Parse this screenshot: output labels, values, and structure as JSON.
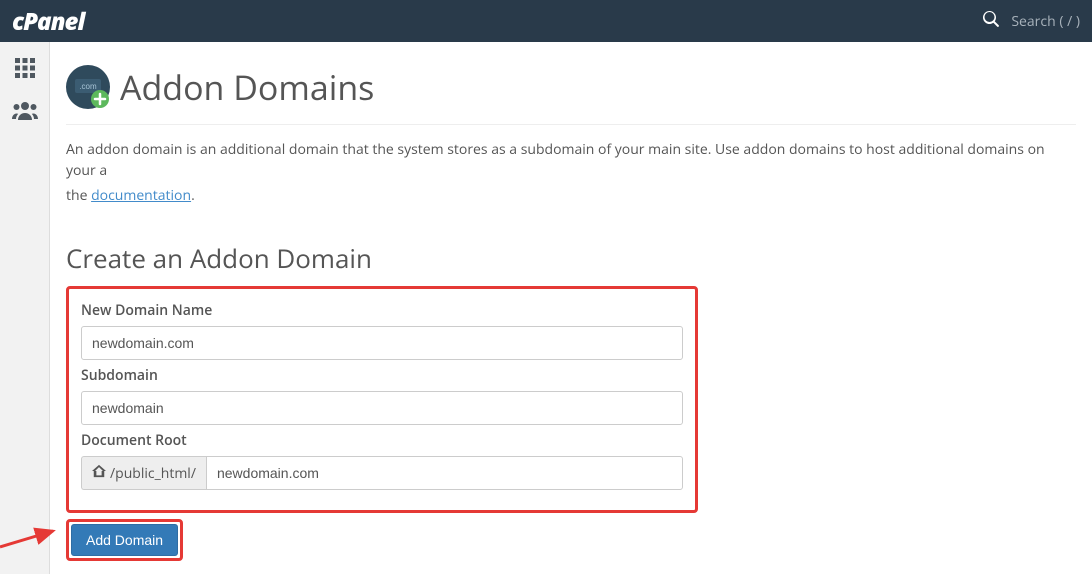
{
  "navbar": {
    "logo_text": "Panel",
    "search_placeholder": "Search ( / )"
  },
  "page": {
    "title": "Addon Domains",
    "description_prefix": "An addon domain is an additional domain that the system stores as a subdomain of your main site. Use addon domains to host additional domains on your a",
    "description_suffix_prefix": "the ",
    "documentation_link_text": "documentation",
    "description_suffix_end": "."
  },
  "form": {
    "section_title": "Create an Addon Domain",
    "new_domain_label": "New Domain Name",
    "new_domain_value": "newdomain.com",
    "subdomain_label": "Subdomain",
    "subdomain_value": "newdomain",
    "docroot_label": "Document Root",
    "docroot_prefix": "/public_html/",
    "docroot_value": "newdomain.com",
    "submit_label": "Add Domain"
  }
}
